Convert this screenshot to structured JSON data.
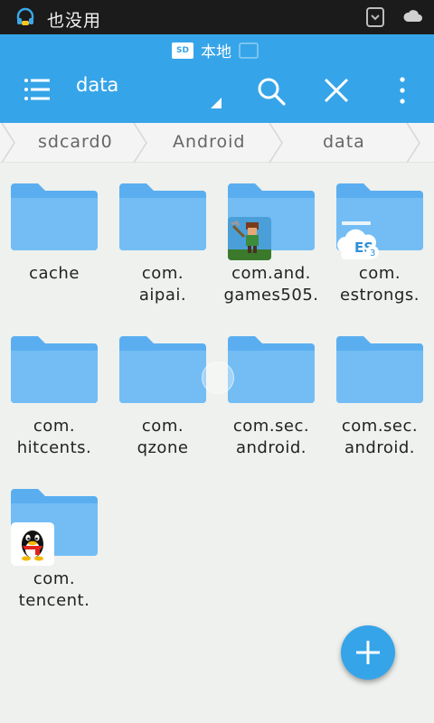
{
  "status_bar": {
    "text": "也没用"
  },
  "toolbar": {
    "storage_badge": "SD",
    "storage_label": "本地",
    "title": "data"
  },
  "breadcrumb": [
    "sdcard0",
    "Android",
    "data"
  ],
  "files": [
    {
      "line1": "cache",
      "line2": ""
    },
    {
      "line1": "com.",
      "line2": "aipai."
    },
    {
      "line1": "com.and.",
      "line2": "games505."
    },
    {
      "line1": "com.",
      "line2": "estrongs."
    },
    {
      "line1": "com.",
      "line2": "hitcents."
    },
    {
      "line1": "com.",
      "line2": "qzone"
    },
    {
      "line1": "com.sec.",
      "line2": "android."
    },
    {
      "line1": "com.sec.",
      "line2": "android."
    },
    {
      "line1": "com.",
      "line2": "tencent."
    }
  ],
  "badges": {
    "es": "ES",
    "es_version": "3"
  },
  "colors": {
    "accent": "#36a4e8",
    "folder": "#5aaef0",
    "folder_light": "#73bdf4"
  },
  "icons": {
    "menu": "menu-icon",
    "search": "search-icon",
    "close": "close-icon",
    "overflow": "overflow-icon",
    "fab": "plus-icon"
  }
}
